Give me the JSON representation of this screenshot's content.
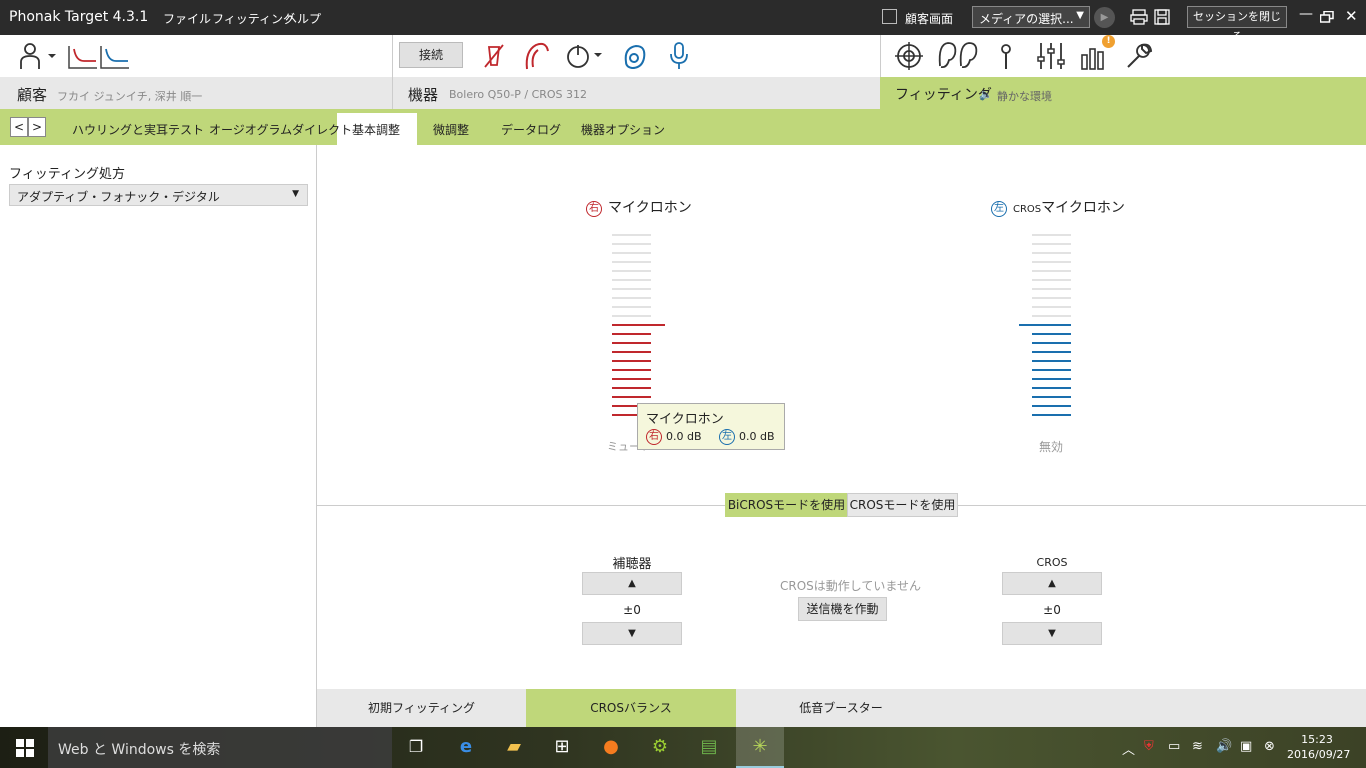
{
  "titlebar": {
    "app_title": "Phonak Target 4.3.1",
    "menus": [
      "ファイル",
      "フィッティング",
      "ヘルプ"
    ],
    "client_screen_label": "顧客画面",
    "media_select_value": "メディアの選択...",
    "close_session_label": "セッションを閉じる"
  },
  "toolbar": {
    "connect_label": "接続",
    "notification_badge": "!"
  },
  "infobar": {
    "client_label": "顧客",
    "client_name": "フカイ ジュンイチ, 深井 順一",
    "device_label": "機器",
    "device_name": "Bolero Q50-P / CROS 312",
    "fitting_label": "フィッティング",
    "environment": "静かな環境"
  },
  "tabs": {
    "items": [
      "ハウリングと実耳テスト",
      "オージオグラムダイレクト",
      "基本調整",
      "微調整",
      "データログ",
      "機器オプション"
    ],
    "active": "基本調整"
  },
  "left": {
    "prescription_label": "フィッティング処方",
    "prescription_value": "アダプティブ・フォナック・デジタル"
  },
  "mics": {
    "right_badge": "右",
    "right_title": "マイクロホン",
    "right_footer": "ミュート",
    "right_level": 0.5,
    "left_badge": "左",
    "left_prefix": "CROS",
    "left_title": "マイクロホン",
    "left_footer": "無効",
    "left_level": 0.5,
    "colors": {
      "right": "#c0282d",
      "left": "#1a6fae",
      "inactive": "#e2e2e2"
    }
  },
  "tooltip": {
    "title": "マイクロホン",
    "right_badge": "右",
    "right_value": "0.0 dB",
    "left_badge": "左",
    "left_value": "0.0 dB"
  },
  "modes": {
    "bicros": "BiCROSモードを使用",
    "cros": "CROSモードを使用"
  },
  "controls": {
    "hearing_aid_title": "補聴器",
    "hearing_aid_value": "±0",
    "cros_title": "CROS",
    "cros_value": "±0",
    "cros_status": "CROSは動作していません",
    "activate_label": "送信機を作動"
  },
  "bottom_tabs": {
    "items": [
      "初期フィッティング",
      "CROSバランス",
      "低音ブースター"
    ],
    "active": "CROSバランス"
  },
  "taskbar": {
    "search_placeholder": "Web と Windows を検索",
    "time": "15:23",
    "date": "2016/09/27"
  },
  "accent_color": "#bfd77a"
}
